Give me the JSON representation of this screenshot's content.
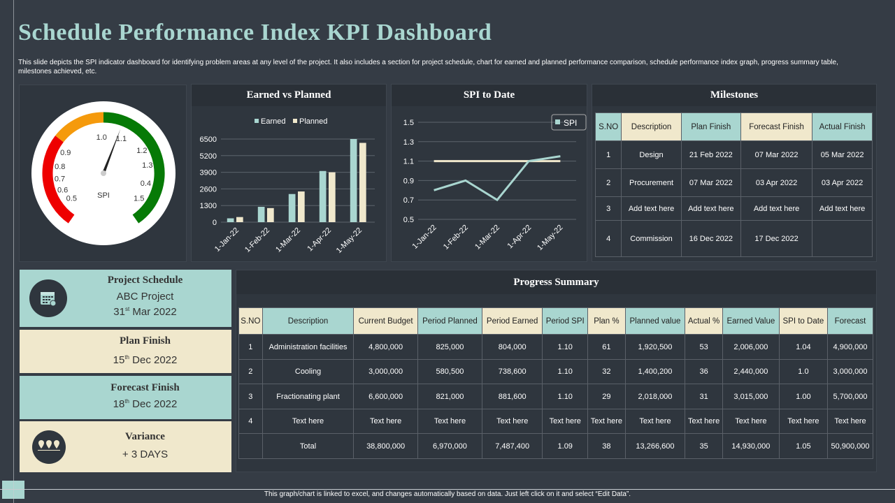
{
  "title": "Schedule Performance Index KPI Dashboard",
  "description": "This slide depicts the SPI indicator dashboard for identifying problem areas at any level of the project. It also includes a section for project schedule, chart for earned and planned performance comparison, schedule performance index graph, progress summary table, milestones achieved, etc.",
  "gauge": {
    "label": "SPI",
    "ticks": [
      "0.5",
      "0.6",
      "0.7",
      "0.8",
      "0.9",
      "1.0",
      "1.1",
      "1.2",
      "1.3",
      "0.4",
      "1.5"
    ],
    "value": 1.07,
    "colors": {
      "red": "#ee0000",
      "orange": "#f59a0c",
      "green": "#067a06"
    }
  },
  "chart_data": [
    {
      "type": "bar",
      "title": "Earned  vs Planned",
      "categories": [
        "1-Jan-22",
        "1-Feb-22",
        "1-Mar-22",
        "1-Apr-22",
        "1-May-22"
      ],
      "yticks": [
        "0",
        "1300",
        "2600",
        "3900",
        "5200",
        "6500"
      ],
      "ylim": [
        0,
        6500
      ],
      "legend": "top",
      "series": [
        {
          "name": "Earned",
          "color": "#a9d6d0",
          "values": [
            300,
            1200,
            2200,
            4000,
            6500
          ]
        },
        {
          "name": "Planned",
          "color": "#f0e8cc",
          "values": [
            400,
            1100,
            2400,
            3900,
            6200
          ]
        }
      ]
    },
    {
      "type": "line",
      "title": "SPI to Date",
      "categories": [
        "1-Jan-22",
        "1-Feb-22",
        "1-Mar-22",
        "1-Apr-22",
        "1-May-22"
      ],
      "yticks": [
        "0.5",
        "0.7",
        "0.9",
        "1.1",
        "1.3",
        "1.5"
      ],
      "ylim": [
        0.5,
        1.5
      ],
      "legend": "top-right",
      "series": [
        {
          "name": "SPI",
          "color": "#a9d6d0",
          "values": [
            0.8,
            0.9,
            0.7,
            1.1,
            1.15
          ]
        },
        {
          "color": "#f0e8cc",
          "values": [
            1.1,
            1.1,
            1.1,
            1.1,
            1.1
          ]
        }
      ]
    }
  ],
  "milestones": {
    "title": "Milestones",
    "headers": [
      "S.NO",
      "Description",
      "Plan Finish",
      "Forecast Finish",
      "Actual Finish"
    ],
    "rows": [
      [
        "1",
        "Design",
        "21 Feb 2022",
        "07 Mar 2022",
        "05 Mar 2022"
      ],
      [
        "2",
        "Procurement",
        "07 Mar 2022",
        "03 Apr 2022",
        "03 Apr 2022"
      ],
      [
        "3",
        "Add text here",
        "Add text here",
        "Add text here",
        "Add text here"
      ],
      [
        "4",
        "Commission",
        "16 Dec 2022",
        "17 Dec 2022",
        ""
      ]
    ]
  },
  "cards": {
    "schedule": {
      "title": "Project Schedule",
      "project": "ABC Project",
      "day": "31",
      "sup": "st",
      "date": "Mar  2022"
    },
    "plan": {
      "title": "Plan Finish",
      "day": "15",
      "sup": "th",
      "date": "Dec 2022"
    },
    "forecast": {
      "title": "Forecast Finish",
      "day": "18",
      "sup": "th",
      "date": "Dec 2022"
    },
    "variance": {
      "title": "Variance",
      "value": "+ 3 DAYS"
    }
  },
  "progress": {
    "title": "Progress Summary",
    "headers": [
      "S.NO",
      "Description",
      "Current Budget",
      "Period Planned",
      "Period Earned",
      "Period SPI",
      "Plan %",
      "Planned value",
      "Actual %",
      "Earned Value",
      "SPI to Date",
      "Forecast"
    ],
    "rows": [
      [
        "1",
        "Administration facilities",
        "4,800,000",
        "825,000",
        "804,000",
        "1.10",
        "61",
        "1,920,500",
        "53",
        "2,006,000",
        "1.04",
        "4,900,000"
      ],
      [
        "2",
        "Cooling",
        "3,000,000",
        "580,500",
        "738,600",
        "1.10",
        "32",
        "1,400,200",
        "36",
        "2,440,000",
        "1.0",
        "3,000,000"
      ],
      [
        "3",
        "Fractionating plant",
        "6,600,000",
        "821,000",
        "881,600",
        "1.10",
        "29",
        "2,018,000",
        "31",
        "3,015,000",
        "1.00",
        "5,700,000"
      ],
      [
        "4",
        "Text here",
        "Text here",
        "Text here",
        "Text here",
        "Text here",
        "Text here",
        "Text here",
        "Text here",
        "Text here",
        "Text here",
        "Text here"
      ],
      [
        "",
        "Total",
        "38,800,000",
        "6,970,000",
        "7,487,400",
        "1.09",
        "38",
        "13,266,600",
        "35",
        "14,930,000",
        "1.05",
        "50,900,000"
      ]
    ]
  },
  "footer": "This graph/chart is linked to excel, and changes automatically based on data. Just left click on it and select “Edit Data”."
}
